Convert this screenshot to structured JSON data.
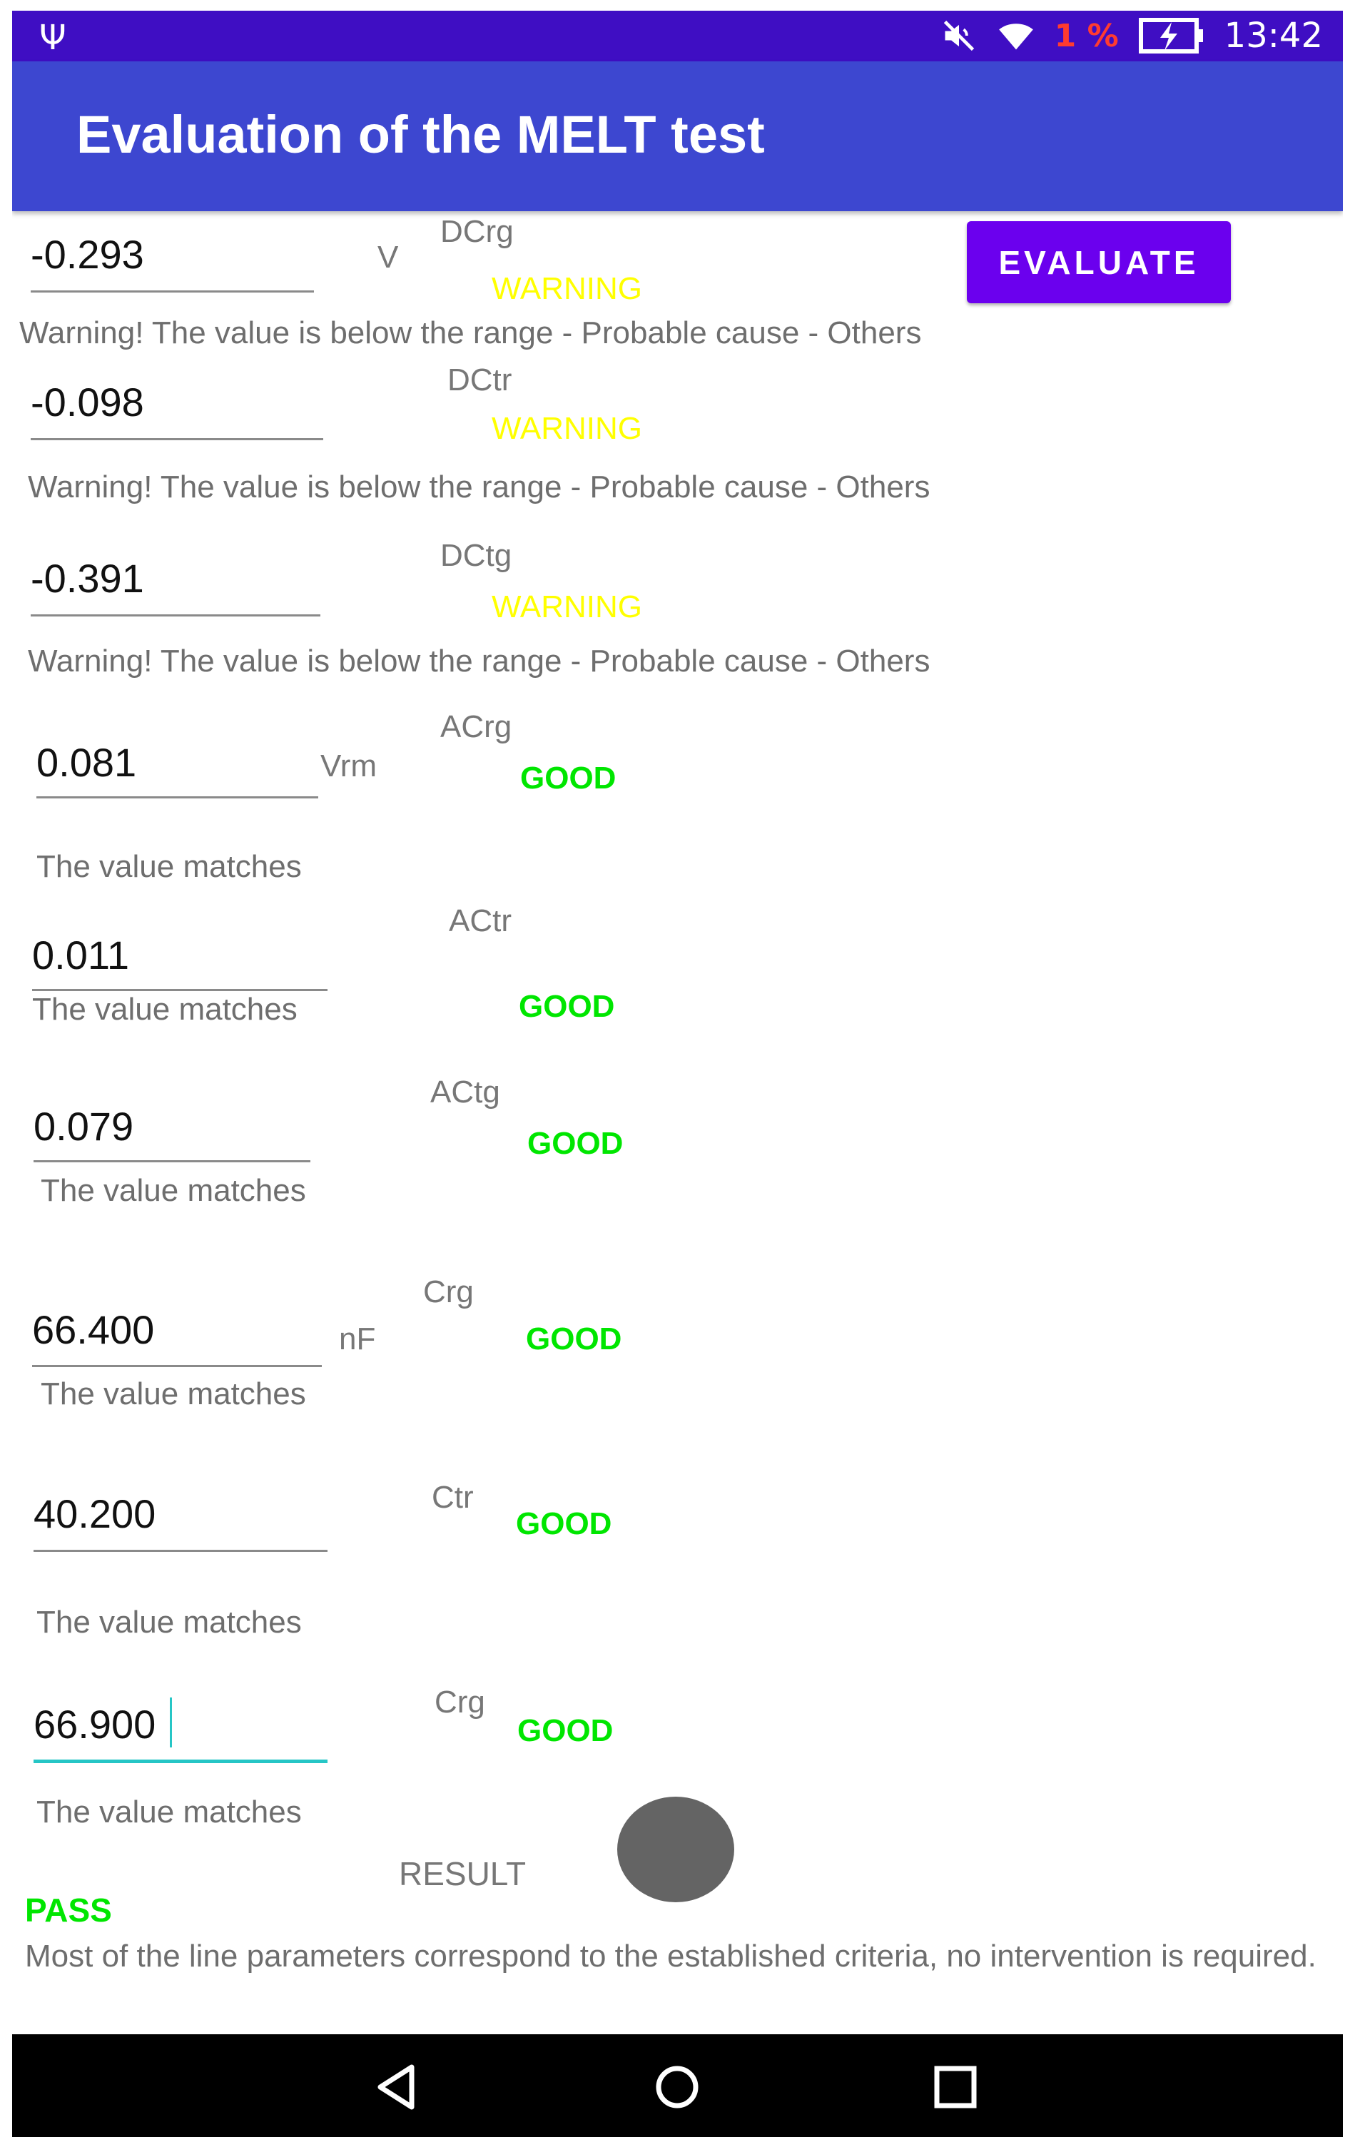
{
  "status_bar": {
    "usb_icon": "usb-icon",
    "mute_icon": "mute-icon",
    "wifi_icon": "wifi-icon",
    "battery_percent": "1 %",
    "battery_icon": "battery-charging-icon",
    "time": "13:42"
  },
  "app_bar": {
    "title": "Evaluation of the MELT test"
  },
  "evaluate_button": {
    "label": "EVALUATE"
  },
  "units": {
    "v": "V",
    "vrm": "Vrm",
    "nf": "nF"
  },
  "rows": [
    {
      "value": "-0.293",
      "param": "DCrg",
      "status": "WARNING",
      "message": "Warning! The value is below the range - Probable cause - Others"
    },
    {
      "value": "-0.098",
      "param": "DCtr",
      "status": "WARNING",
      "message": "Warning! The value is below the range - Probable cause - Others"
    },
    {
      "value": "-0.391",
      "param": "DCtg",
      "status": "WARNING",
      "message": "Warning! The value is below the range - Probable cause - Others"
    },
    {
      "value": "0.081",
      "param": "ACrg",
      "status": "GOOD",
      "message": "The value matches"
    },
    {
      "value": "0.011",
      "param": "ACtr",
      "status": "GOOD",
      "message": "The value matches"
    },
    {
      "value": "0.079",
      "param": "ACtg",
      "status": "GOOD",
      "message": "The value matches"
    },
    {
      "value": "66.400",
      "param": "Crg",
      "status": "GOOD",
      "message": "The value matches"
    },
    {
      "value": "40.200",
      "param": "Ctr",
      "status": "GOOD",
      "message": "The value matches"
    },
    {
      "value": "66.900",
      "param": "Crg",
      "status": "GOOD",
      "message": "The value matches"
    }
  ],
  "result": {
    "label": "RESULT",
    "status": "PASS",
    "summary": "Most of the line parameters correspond to the established criteria, no intervention is required."
  },
  "nav_bar": {
    "back_icon": "back-icon",
    "home_icon": "home-icon",
    "recents_icon": "recents-icon"
  },
  "colors": {
    "status_bar": "#3f0ec3",
    "app_bar": "#3d47d0",
    "button": "#6b00ee",
    "warning": "#ffff00",
    "good": "#00e600",
    "focus": "#26c6c6"
  }
}
